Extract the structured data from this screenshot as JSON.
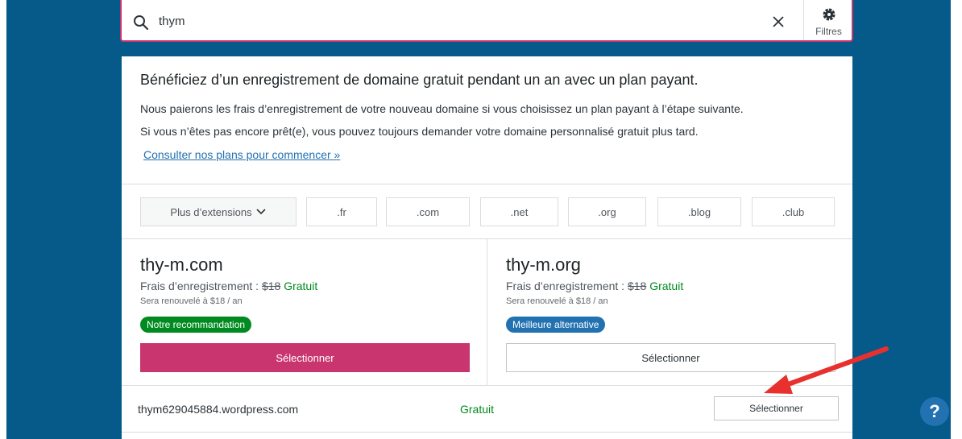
{
  "search": {
    "value": "thym",
    "filters_label": "Filtres"
  },
  "promo": {
    "title": "Bénéficiez d’un enregistrement de domaine gratuit pendant un an avec un plan payant.",
    "line1": "Nous paierons les frais d’enregistrement de votre nouveau domaine si vous choisissez un plan payant à l’étape suivante.",
    "line2": "Si vous n’êtes pas encore prêt(e), vous pouvez toujours demander votre domaine personnalisé gratuit plus tard.",
    "link": "Consulter nos plans pour commencer »"
  },
  "tld_filters": {
    "more_label": "Plus d’extensions",
    "items": [
      ".fr",
      ".com",
      ".net",
      ".org",
      ".blog",
      ".club"
    ]
  },
  "suggestions": [
    {
      "domain": "thy-m.com",
      "price_label": "Frais d’enregistrement :",
      "old_price": "$18",
      "free_label": "Gratuit",
      "renewal": "Sera renouvelé à $18 / an",
      "badge": "Notre recommandation",
      "badge_color": "#008a20",
      "select_label": "Sélectionner"
    },
    {
      "domain": "thy-m.org",
      "price_label": "Frais d’enregistrement :",
      "old_price": "$18",
      "free_label": "Gratuit",
      "renewal": "Sera renouvelé à $18 / an",
      "badge": "Meilleure alternative",
      "badge_color": "#2271b1",
      "select_label": "Sélectionner"
    }
  ],
  "wpcom_option": {
    "domain": "thym629045884.wordpress.com",
    "price": "Gratuit",
    "select_label": "Sélectionner"
  },
  "help": {
    "label": "?"
  },
  "colors": {
    "background": "#055a8a",
    "accent": "#c9356e",
    "free_text": "#008a20",
    "link": "#2271b1",
    "annotation_arrow": "#e8302e"
  }
}
